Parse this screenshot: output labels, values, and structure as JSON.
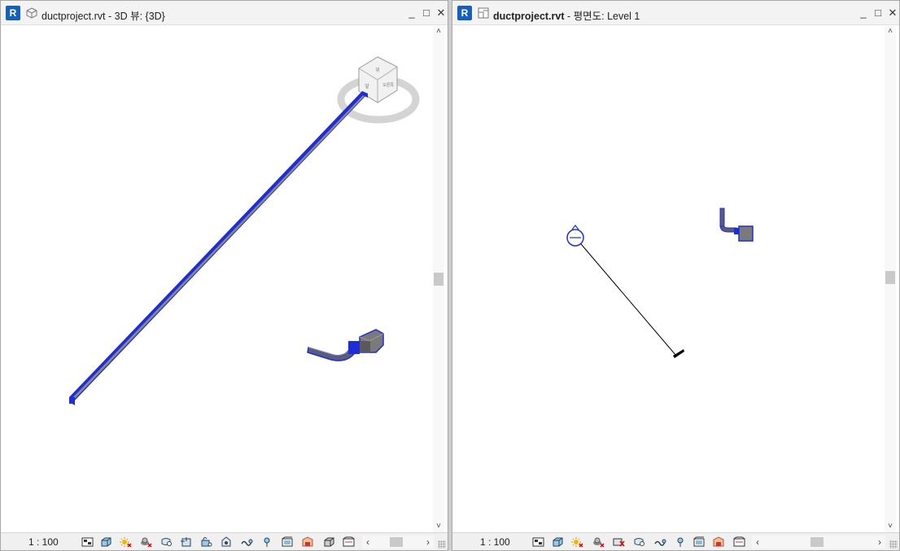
{
  "left_view": {
    "title_file": "ductproject.rvt",
    "title_view": " - 3D 뷰: {3D}",
    "app_icon_letter": "R",
    "view_icon": "3d-view-icon",
    "scale": "1 : 100",
    "window_buttons": {
      "minimize": "_",
      "maximize": "□",
      "close": "✕"
    },
    "scroll": {
      "up": "˄",
      "down": "˅",
      "left": "‹",
      "right": "›"
    },
    "toolbar_icons": [
      "detail-level-icon",
      "visual-style-icon",
      "sun-path-icon",
      "shadows-icon",
      "crop-view-icon",
      "show-crop-icon",
      "unlock-3d-icon",
      "temporary-hide-icon",
      "reveal-hidden-icon",
      "worksharing-icon",
      "analytical-model-icon",
      "highlight-displacement-icon",
      "reveal-constraints-icon",
      "locked-view-icon"
    ]
  },
  "right_view": {
    "title_file": "ductproject.rvt",
    "title_view": " - 평면도: Level 1",
    "app_icon_letter": "R",
    "view_icon": "floor-plan-icon",
    "scale": "1 : 100",
    "window_buttons": {
      "minimize": "_",
      "maximize": "□",
      "close": "✕"
    },
    "scroll": {
      "up": "˄",
      "down": "˅",
      "left": "‹",
      "right": "›"
    },
    "toolbar_icons": [
      "detail-level-icon",
      "visual-style-icon",
      "sun-path-icon",
      "shadows-icon",
      "crop-view-icon",
      "show-crop-icon",
      "temporary-hide-icon",
      "reveal-hidden-icon",
      "worksharing-icon",
      "design-options-icon",
      "analytical-model-icon",
      "highlight-displacement-icon",
      "reveal-constraints-icon"
    ]
  },
  "viewcube": {
    "face_top": "위",
    "face_front": "앞",
    "face_right": "오른쪽"
  },
  "colors": {
    "selection_blue": "#1f2dd8",
    "duct_gray": "#7a7a7a",
    "revit_blue": "#1560bd"
  }
}
